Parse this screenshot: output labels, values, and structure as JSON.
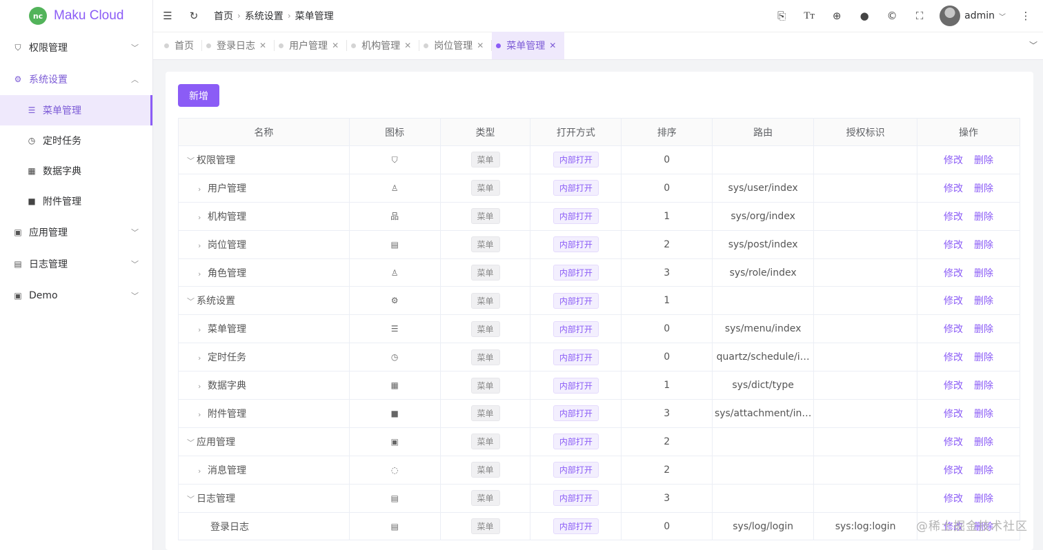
{
  "app": {
    "logo_badge": "nc",
    "title": "Maku Cloud"
  },
  "sidebar": {
    "items": [
      {
        "label": "权限管理",
        "icon": "shield-icon",
        "glyph": "⛉",
        "state": "collapsed"
      },
      {
        "label": "系统设置",
        "icon": "gear-icon",
        "glyph": "⚙",
        "state": "expanded",
        "children": [
          {
            "label": "菜单管理",
            "icon": "list-icon",
            "glyph": "☰",
            "active": true
          },
          {
            "label": "定时任务",
            "icon": "clock-icon",
            "glyph": "◷"
          },
          {
            "label": "数据字典",
            "icon": "grid-icon",
            "glyph": "▦"
          },
          {
            "label": "附件管理",
            "icon": "folder-icon",
            "glyph": "■"
          }
        ]
      },
      {
        "label": "应用管理",
        "icon": "apps-icon",
        "glyph": "▣",
        "state": "collapsed"
      },
      {
        "label": "日志管理",
        "icon": "log-icon",
        "glyph": "▤",
        "state": "collapsed"
      },
      {
        "label": "Demo",
        "icon": "demo-icon",
        "glyph": "▣",
        "state": "collapsed"
      }
    ]
  },
  "header": {
    "breadcrumb": [
      "首页",
      "系统设置",
      "菜单管理"
    ],
    "user": "admin",
    "tool_icons": [
      "translate-icon",
      "font-size-icon",
      "globe-icon",
      "github-icon",
      "copyright-icon",
      "fullscreen-icon"
    ]
  },
  "tabs": [
    {
      "label": "首页",
      "closable": false
    },
    {
      "label": "登录日志",
      "closable": true
    },
    {
      "label": "用户管理",
      "closable": true
    },
    {
      "label": "机构管理",
      "closable": true
    },
    {
      "label": "岗位管理",
      "closable": true
    },
    {
      "label": "菜单管理",
      "closable": true,
      "active": true
    }
  ],
  "toolbar": {
    "add_label": "新增"
  },
  "table": {
    "columns": [
      "名称",
      "图标",
      "类型",
      "打开方式",
      "排序",
      "路由",
      "授权标识",
      "操作"
    ],
    "rows": [
      {
        "name": "权限管理",
        "level": 0,
        "expander": "open",
        "icon": "shield-icon",
        "glyph": "⛉",
        "type": "菜单",
        "open": "内部打开",
        "sort": "0",
        "route": "",
        "perm": ""
      },
      {
        "name": "用户管理",
        "level": 1,
        "expander": "closed",
        "icon": "user-icon",
        "glyph": "♙",
        "type": "菜单",
        "open": "内部打开",
        "sort": "0",
        "route": "sys/user/index",
        "perm": ""
      },
      {
        "name": "机构管理",
        "level": 1,
        "expander": "closed",
        "icon": "org-icon",
        "glyph": "品",
        "type": "菜单",
        "open": "内部打开",
        "sort": "1",
        "route": "sys/org/index",
        "perm": ""
      },
      {
        "name": "岗位管理",
        "level": 1,
        "expander": "closed",
        "icon": "post-icon",
        "glyph": "▤",
        "type": "菜单",
        "open": "内部打开",
        "sort": "2",
        "route": "sys/post/index",
        "perm": ""
      },
      {
        "name": "角色管理",
        "level": 1,
        "expander": "closed",
        "icon": "role-icon",
        "glyph": "♙",
        "type": "菜单",
        "open": "内部打开",
        "sort": "3",
        "route": "sys/role/index",
        "perm": ""
      },
      {
        "name": "系统设置",
        "level": 0,
        "expander": "open",
        "icon": "gear-icon",
        "glyph": "⚙",
        "type": "菜单",
        "open": "内部打开",
        "sort": "1",
        "route": "",
        "perm": ""
      },
      {
        "name": "菜单管理",
        "level": 1,
        "expander": "closed",
        "icon": "list-icon",
        "glyph": "☰",
        "type": "菜单",
        "open": "内部打开",
        "sort": "0",
        "route": "sys/menu/index",
        "perm": ""
      },
      {
        "name": "定时任务",
        "level": 1,
        "expander": "closed",
        "icon": "clock-icon",
        "glyph": "◷",
        "type": "菜单",
        "open": "内部打开",
        "sort": "0",
        "route": "quartz/schedule/i…",
        "perm": ""
      },
      {
        "name": "数据字典",
        "level": 1,
        "expander": "closed",
        "icon": "grid-icon",
        "glyph": "▦",
        "type": "菜单",
        "open": "内部打开",
        "sort": "1",
        "route": "sys/dict/type",
        "perm": ""
      },
      {
        "name": "附件管理",
        "level": 1,
        "expander": "closed",
        "icon": "folder-icon",
        "glyph": "■",
        "type": "菜单",
        "open": "内部打开",
        "sort": "3",
        "route": "sys/attachment/in…",
        "perm": ""
      },
      {
        "name": "应用管理",
        "level": 0,
        "expander": "open",
        "icon": "apps-icon",
        "glyph": "▣",
        "type": "菜单",
        "open": "内部打开",
        "sort": "2",
        "route": "",
        "perm": ""
      },
      {
        "name": "消息管理",
        "level": 1,
        "expander": "closed",
        "icon": "message-icon",
        "glyph": "◌",
        "type": "菜单",
        "open": "内部打开",
        "sort": "2",
        "route": "",
        "perm": ""
      },
      {
        "name": "日志管理",
        "level": 0,
        "expander": "open",
        "icon": "log-icon",
        "glyph": "▤",
        "type": "菜单",
        "open": "内部打开",
        "sort": "3",
        "route": "",
        "perm": ""
      },
      {
        "name": "登录日志",
        "level": 1,
        "expander": "none",
        "icon": "log-icon",
        "glyph": "▤",
        "type": "菜单",
        "open": "内部打开",
        "sort": "0",
        "route": "sys/log/login",
        "perm": "sys:log:login"
      }
    ],
    "op_edit": "修改",
    "op_delete": "删除"
  },
  "watermark": "@稀土掘金技术社区",
  "colors": {
    "accent": "#8b5cf6",
    "accent_bg": "#efe9fc"
  }
}
